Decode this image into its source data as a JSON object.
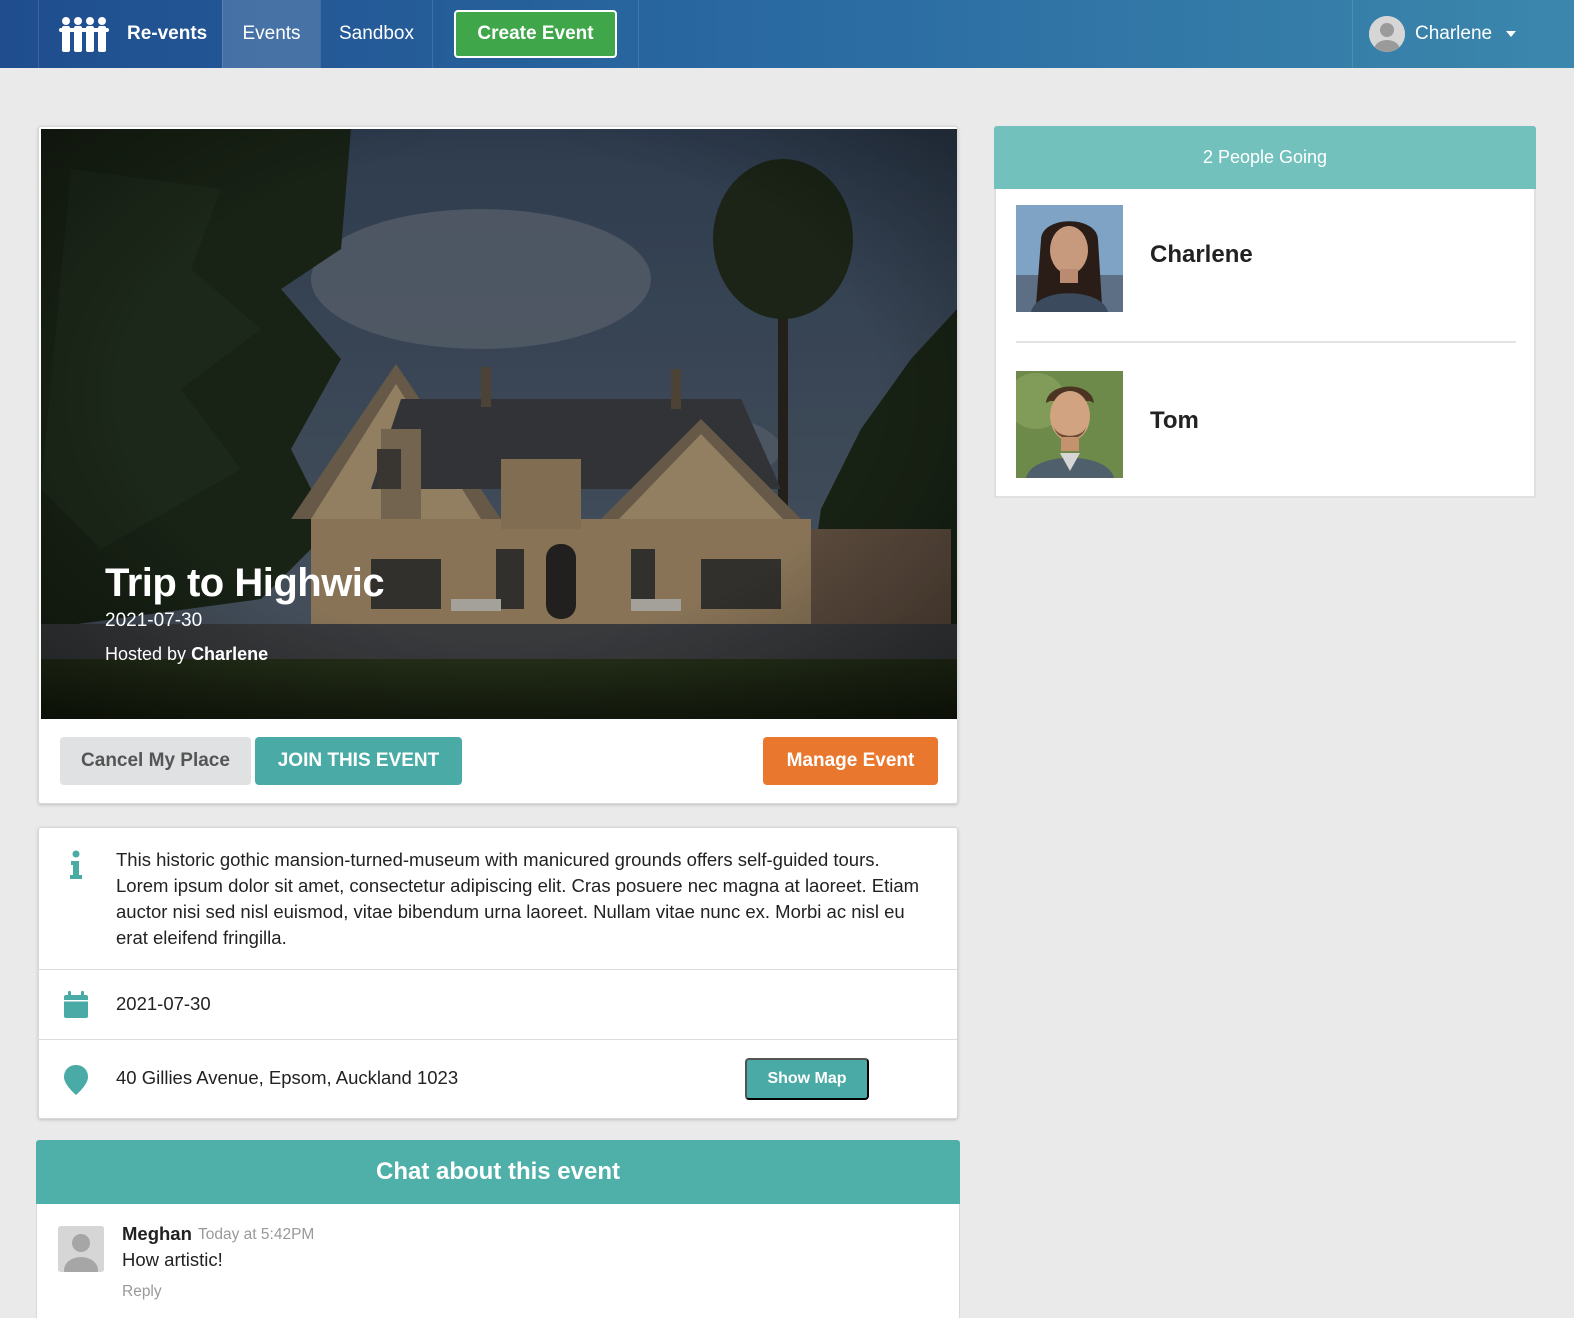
{
  "navbar": {
    "brand": "Re-vents",
    "events": "Events",
    "sandbox": "Sandbox",
    "create_event": "Create Event",
    "user_name": "Charlene",
    "brand_color": "#1f4d8e",
    "create_color": "#3fa74a"
  },
  "event": {
    "title": "Trip to Highwic",
    "date": "2021-07-30",
    "hosted_by_prefix": "Hosted by",
    "host": "Charlene",
    "actions": {
      "cancel": "Cancel My Place",
      "join": "JOIN THIS EVENT",
      "manage": "Manage Event"
    },
    "details": {
      "description": "This historic gothic mansion-turned-museum with manicured grounds offers self-guided tours. Lorem ipsum dolor sit amet, consectetur adipiscing elit. Cras posuere nec magna at laoreet. Etiam auctor nisi sed nisl euismod, vitae bibendum urna laoreet. Nullam vitae nunc ex. Morbi ac nisl eu erat eleifend fringilla.",
      "date": "2021-07-30",
      "venue": "40 Gillies Avenue, Epsom, Auckland 1023",
      "show_map": "Show Map"
    }
  },
  "chat": {
    "header": "Chat about this event",
    "comments": [
      {
        "author": "Meghan",
        "time": "Today at 5:42PM",
        "text": "How artistic!",
        "reply": "Reply"
      }
    ]
  },
  "sidebar": {
    "header": "2 People Going",
    "attendees": [
      {
        "name": "Charlene"
      },
      {
        "name": "Tom"
      }
    ]
  },
  "colors": {
    "teal": "#4aaaa5",
    "orange": "#e9782e",
    "sidebar_header": "#72c1bd"
  }
}
